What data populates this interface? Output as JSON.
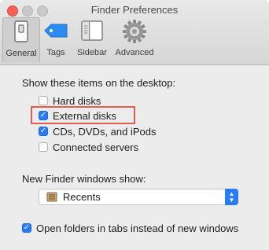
{
  "window": {
    "title": "Finder Preferences"
  },
  "toolbar": {
    "items": [
      {
        "label": "General",
        "icon": "general-switch-icon",
        "selected": true
      },
      {
        "label": "Tags",
        "icon": "tag-icon",
        "selected": false
      },
      {
        "label": "Sidebar",
        "icon": "sidebar-icon",
        "selected": false
      },
      {
        "label": "Advanced",
        "icon": "gear-icon",
        "selected": false
      }
    ]
  },
  "desktop_section": {
    "heading": "Show these items on the desktop:",
    "items": [
      {
        "label": "Hard disks",
        "checked": false
      },
      {
        "label": "External disks",
        "checked": true
      },
      {
        "label": "CDs, DVDs, and iPods",
        "checked": true
      },
      {
        "label": "Connected servers",
        "checked": false
      }
    ]
  },
  "new_window_section": {
    "heading": "New Finder windows show:",
    "selected_value": "Recents",
    "icon": "recents-icon"
  },
  "tabs_option": {
    "label": "Open folders in tabs instead of new windows",
    "checked": true
  },
  "colors": {
    "accent": "#2a7cf6",
    "highlight": "#e55b4c",
    "close": "#fc5f57"
  }
}
